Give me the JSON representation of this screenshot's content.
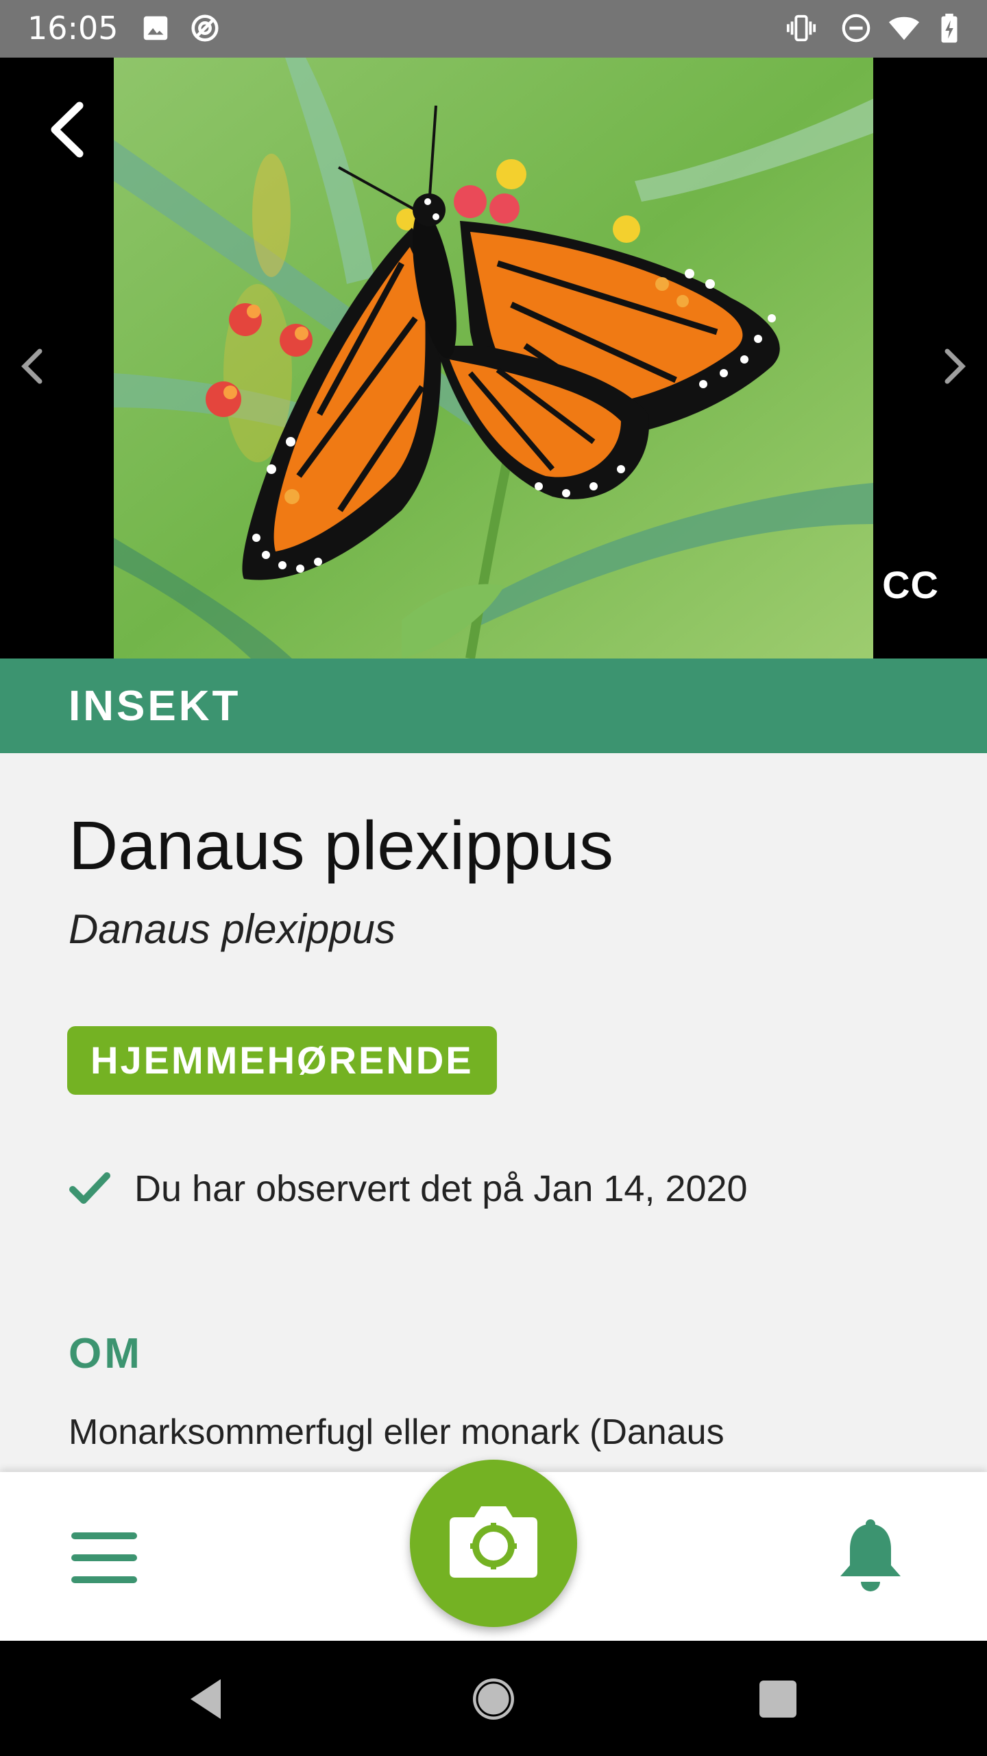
{
  "status_bar": {
    "time": "16:05",
    "left_icons": [
      "image-icon",
      "sync-disabled-icon"
    ],
    "right_icons": [
      "vibrate-icon",
      "dnd-icon",
      "wifi-icon",
      "battery-charging-icon"
    ]
  },
  "hero": {
    "back_icon": "back-chevron-icon",
    "prev_icon": "chevron-left-icon",
    "next_icon": "chevron-right-icon",
    "license_label": "CC"
  },
  "category": {
    "label": "INSEKT"
  },
  "species": {
    "common_name": "Danaus plexippus",
    "scientific_name": "Danaus plexippus",
    "status_badge": "HJEMMEHØRENDE",
    "observed_text": "Du har observert det på Jan 14, 2020"
  },
  "about": {
    "heading": "OM",
    "text": "Monarksommerfugl eller monark (Danaus"
  },
  "bottom_bar": {
    "menu_icon": "hamburger-menu-icon",
    "camera_icon": "camera-icon",
    "notification_icon": "bell-icon"
  },
  "colors": {
    "accent_green": "#3c9470",
    "badge_green": "#74b223",
    "status_bar": "#757575"
  }
}
